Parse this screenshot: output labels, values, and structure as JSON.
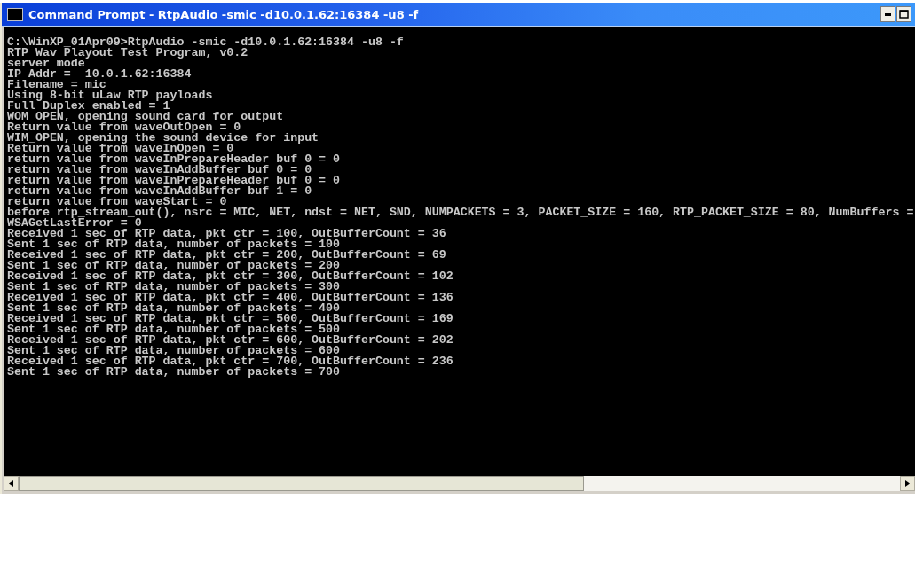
{
  "window": {
    "title": "Command Prompt - RtpAudio -smic -d10.0.1.62:16384 -u8 -f"
  },
  "console": {
    "lines": [
      "C:\\WinXP_01Apr09>RtpAudio -smic -d10.0.1.62:16384 -u8 -f",
      "RTP Wav Playout Test Program, v0.2",
      "server mode",
      "IP Addr =  10.0.1.62:16384",
      "Filename = mic",
      "Using 8-bit uLaw RTP payloads",
      "Full Duplex enabled = 1",
      "WOM_OPEN, opening sound card for output",
      "Return value from waveOutOpen = 0",
      "WIM_OPEN, opening the sound device for input",
      "Return value from waveInOpen = 0",
      "return value from waveInPrepareHeader buf 0 = 0",
      "return value from waveInAddBuffer buf 0 = 0",
      "return value from waveInPrepareHeader buf 0 = 0",
      "return value from waveInAddBuffer buf 1 = 0",
      "return value from waveStart = 0",
      "before rtp_stream_out(), nsrc = MIC, NET, ndst = NET, SND, NUMPACKETS = 3, PACKET_SIZE = 160, RTP_PACKET_SIZE = 80, NumBuffers =",
      "WSAGetLastError = 0",
      "Received 1 sec of RTP data, pkt ctr = 100, OutBufferCount = 36",
      "Sent 1 sec of RTP data, number of packets = 100",
      "Received 1 sec of RTP data, pkt ctr = 200, OutBufferCount = 69",
      "Sent 1 sec of RTP data, number of packets = 200",
      "Received 1 sec of RTP data, pkt ctr = 300, OutBufferCount = 102",
      "Sent 1 sec of RTP data, number of packets = 300",
      "Received 1 sec of RTP data, pkt ctr = 400, OutBufferCount = 136",
      "Sent 1 sec of RTP data, number of packets = 400",
      "Received 1 sec of RTP data, pkt ctr = 500, OutBufferCount = 169",
      "Sent 1 sec of RTP data, number of packets = 500",
      "Received 1 sec of RTP data, pkt ctr = 600, OutBufferCount = 202",
      "Sent 1 sec of RTP data, number of packets = 600",
      "Received 1 sec of RTP data, pkt ctr = 700, OutBufferCount = 236",
      "Sent 1 sec of RTP data, number of packets = 700"
    ]
  }
}
